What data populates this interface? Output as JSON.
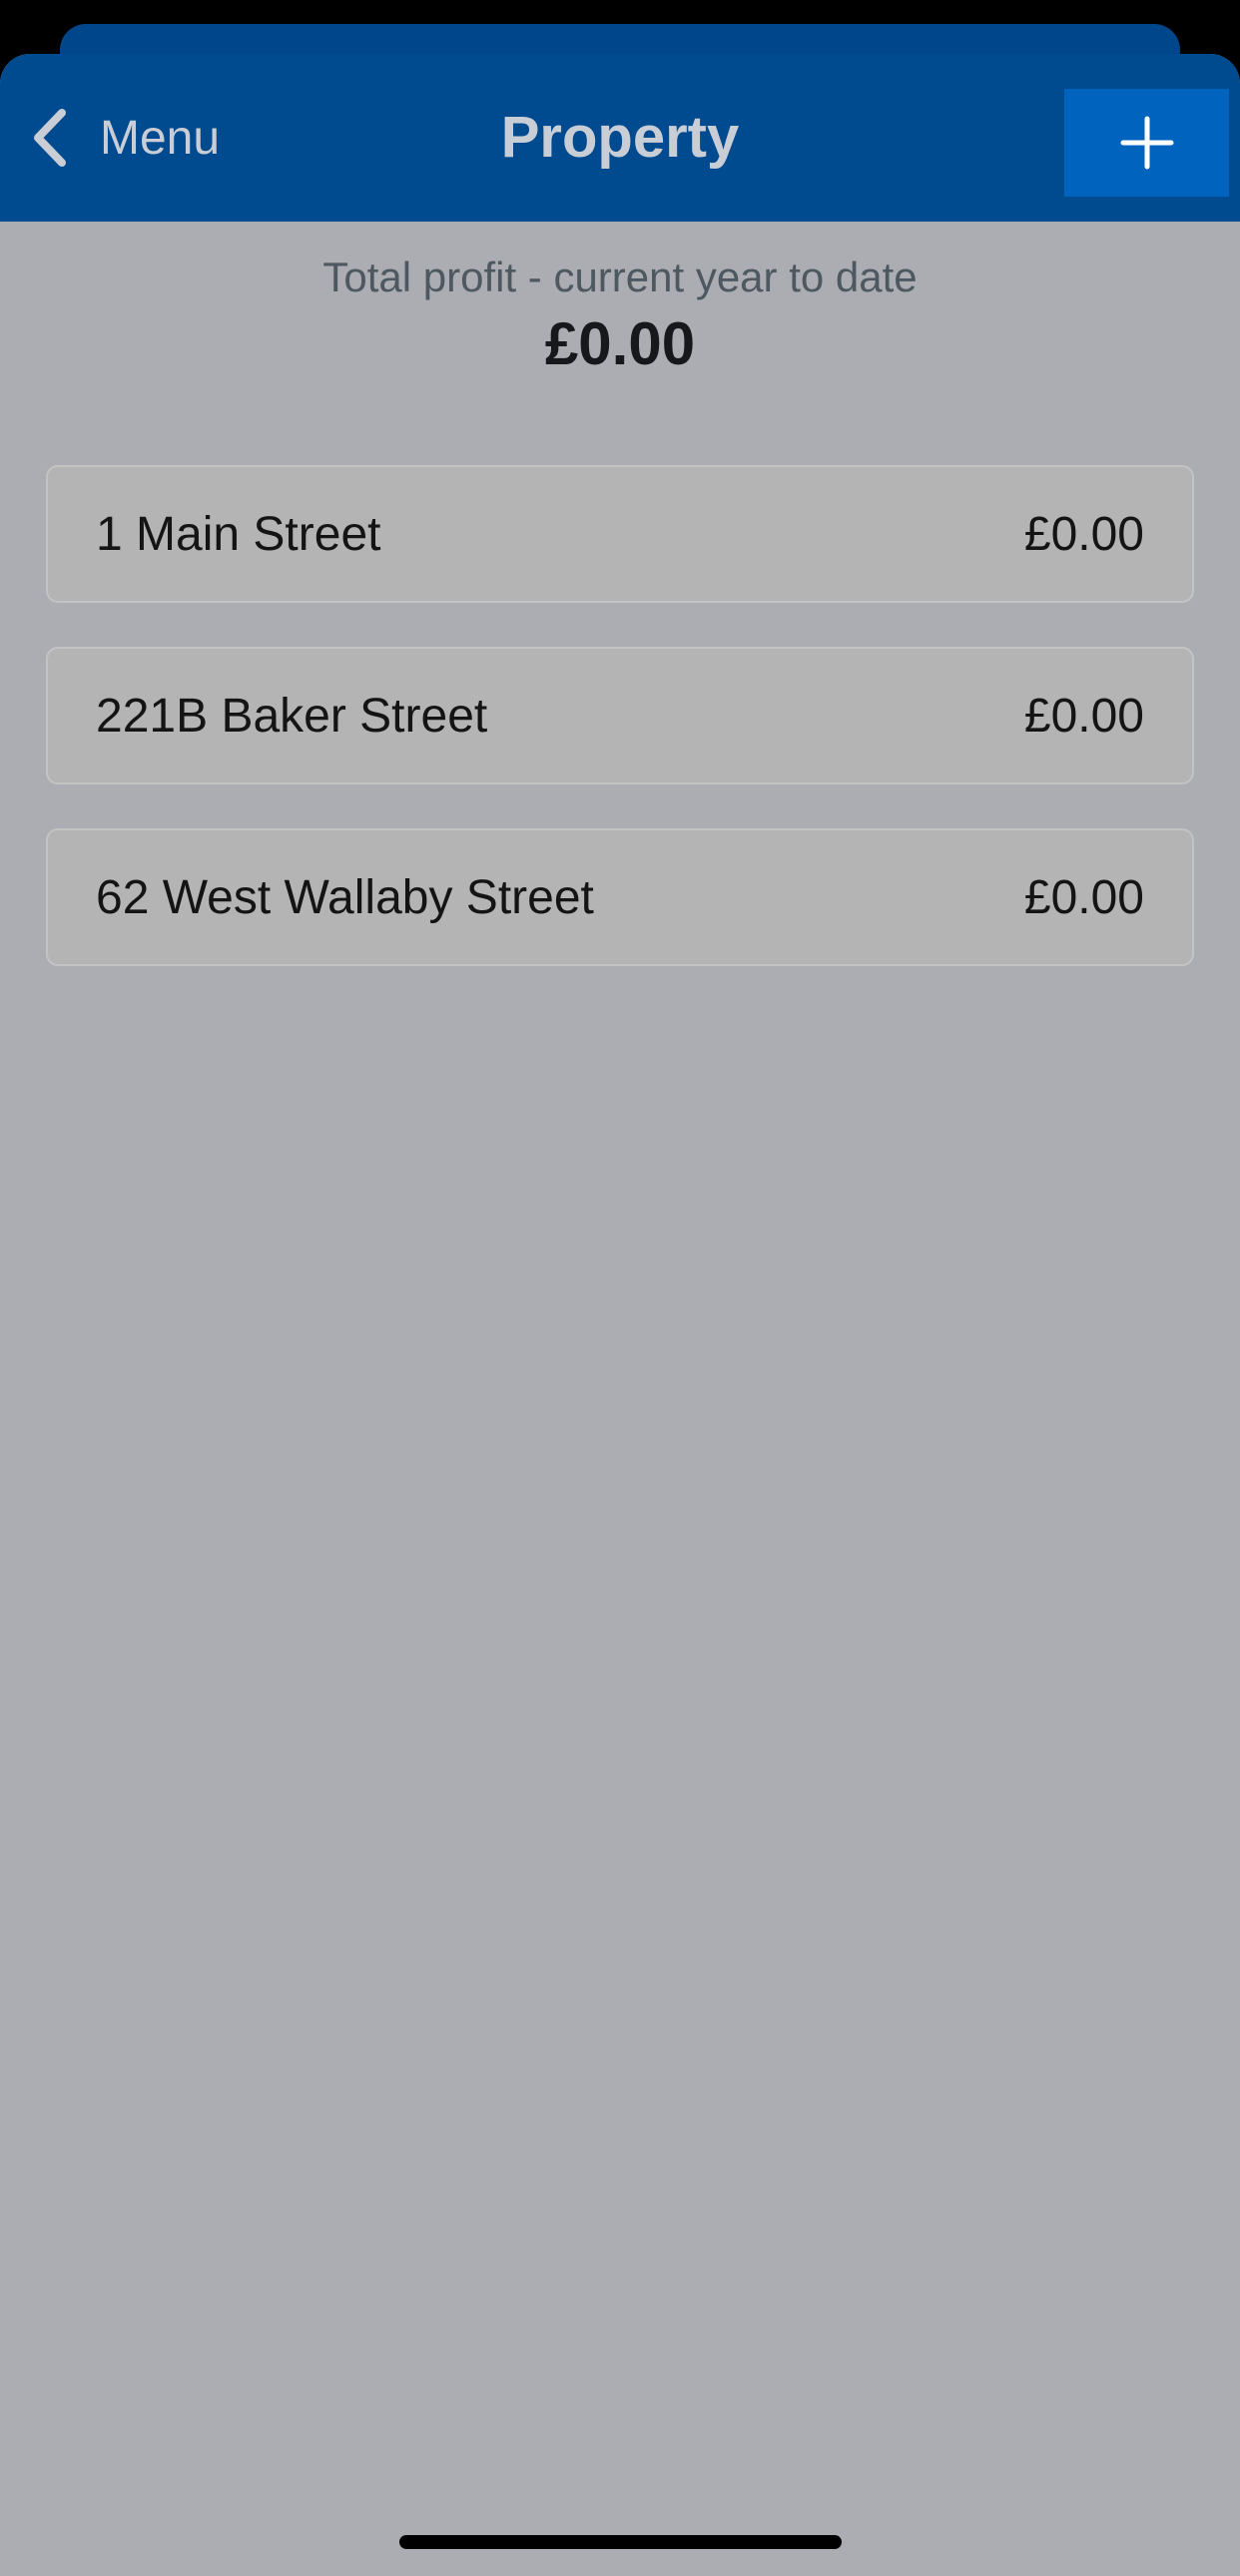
{
  "navbar": {
    "back_label": "Menu",
    "title": "Property",
    "back_icon": "chevron-left-icon",
    "add_icon": "plus-icon"
  },
  "summary": {
    "label": "Total profit - current year to date",
    "value": "£0.00"
  },
  "properties": [
    {
      "name": "1 Main Street",
      "amount": "£0.00"
    },
    {
      "name": "221B Baker Street",
      "amount": "£0.00"
    },
    {
      "name": "62 West Wallaby Street",
      "amount": "£0.00"
    }
  ],
  "colors": {
    "navbar": "#004a8f",
    "add_button": "#0064be",
    "background": "#acadb2",
    "card": "#b4b4b4"
  }
}
